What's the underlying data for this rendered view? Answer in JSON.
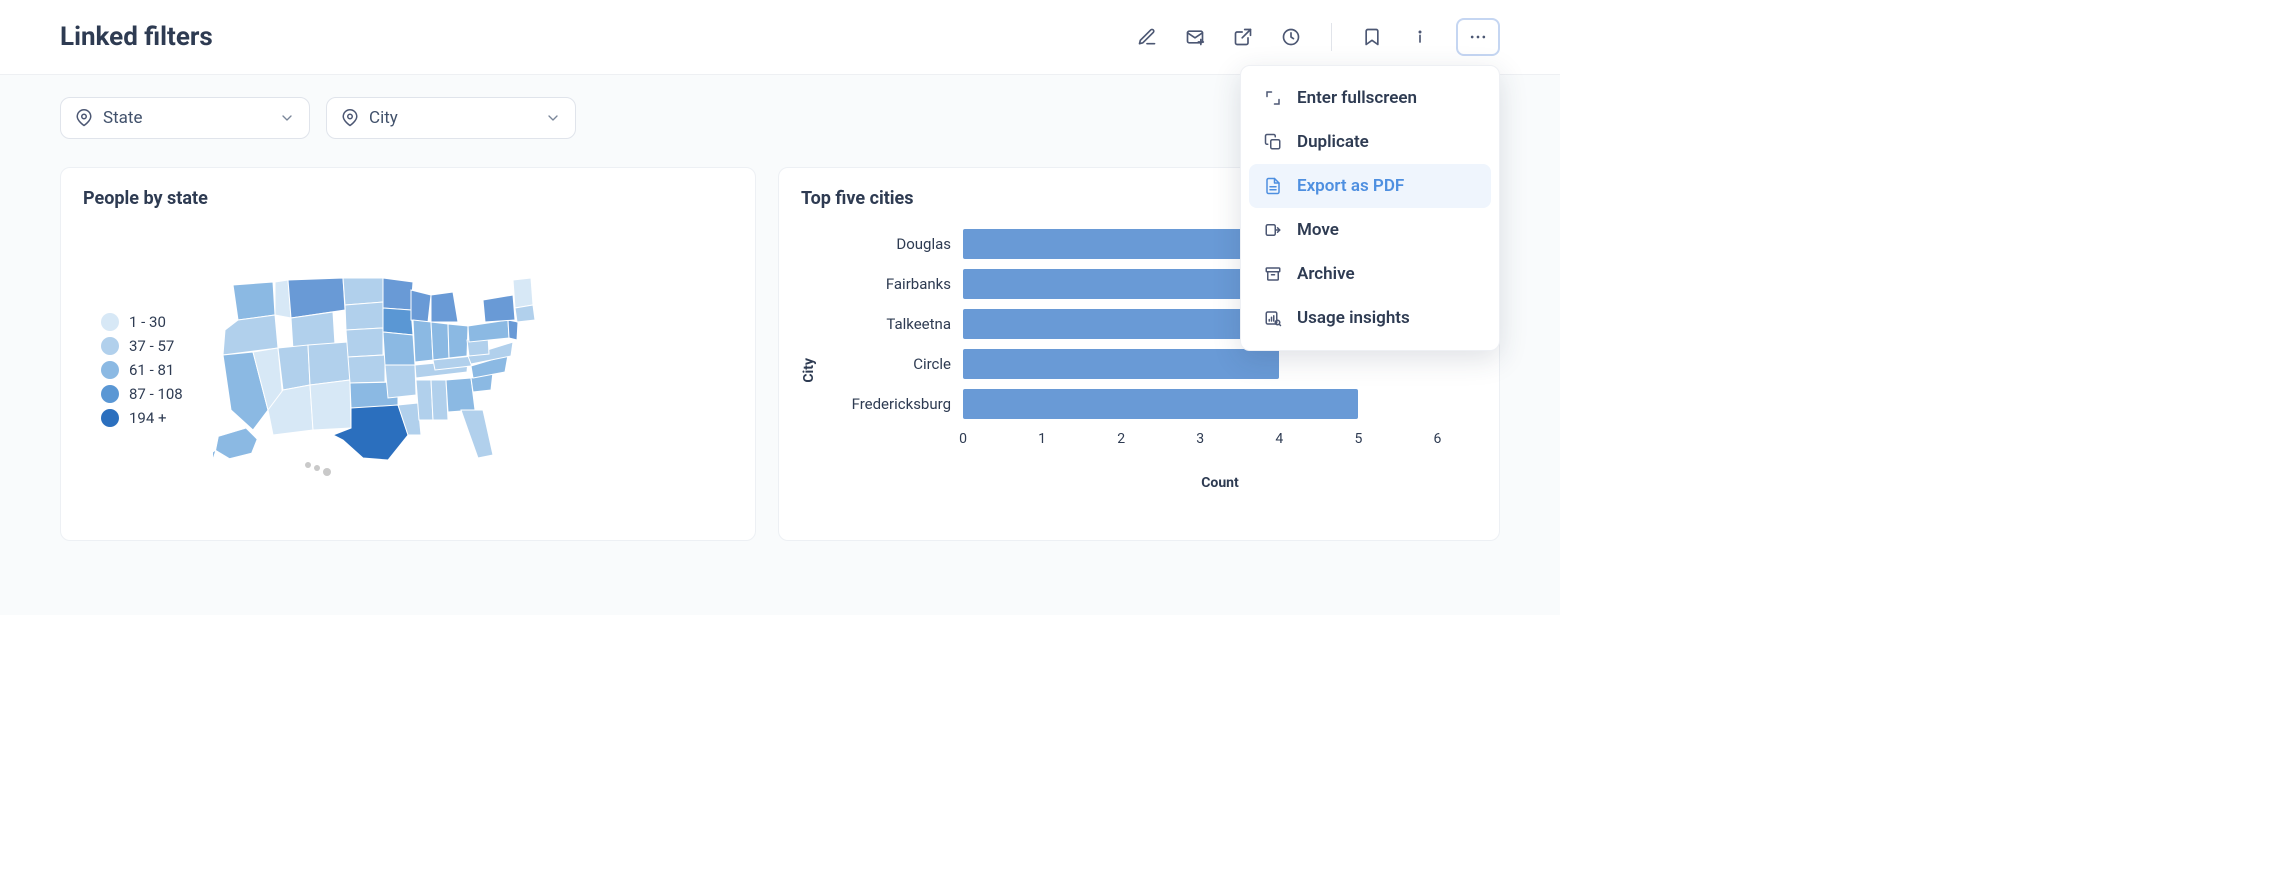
{
  "header": {
    "title": "Linked filters"
  },
  "filters": [
    {
      "label": "State"
    },
    {
      "label": "City"
    }
  ],
  "cards": {
    "map": {
      "title": "People by state",
      "legend": [
        {
          "label": "1 - 30",
          "color": "#d7e8f6"
        },
        {
          "label": "37 - 57",
          "color": "#b1d0ec"
        },
        {
          "label": "61 - 81",
          "color": "#8bb9e3"
        },
        {
          "label": "87 - 108",
          "color": "#5a97d4"
        },
        {
          "label": "194 +",
          "color": "#2b6fbe"
        }
      ]
    },
    "chart": {
      "title": "Top five cities"
    }
  },
  "menu": {
    "items": [
      {
        "label": "Enter fullscreen"
      },
      {
        "label": "Duplicate"
      },
      {
        "label": "Export as PDF"
      },
      {
        "label": "Move"
      },
      {
        "label": "Archive"
      },
      {
        "label": "Usage insights"
      }
    ],
    "hovered_index": 2
  },
  "chart_data": {
    "type": "bar",
    "orientation": "horizontal",
    "categories": [
      "Douglas",
      "Fairbanks",
      "Talkeetna",
      "Circle",
      "Fredericksburg"
    ],
    "values": [
      4,
      4,
      4,
      4,
      5
    ],
    "xlabel": "Count",
    "ylabel": "City",
    "xlim": [
      0,
      6.5
    ],
    "x_ticks": [
      0,
      1,
      2,
      3,
      4,
      5,
      6
    ],
    "bar_color": "#699ad6"
  }
}
